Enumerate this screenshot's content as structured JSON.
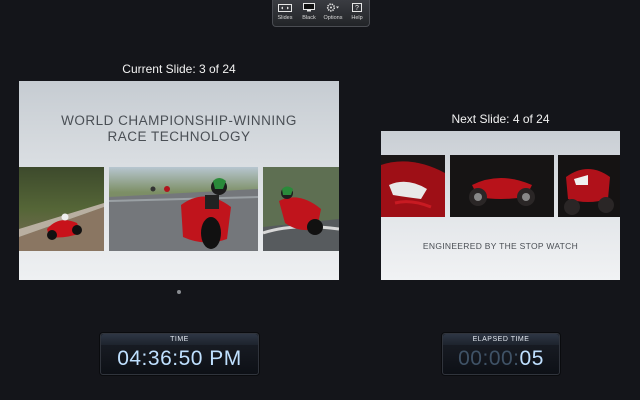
{
  "toolbar": {
    "items": [
      {
        "label": "Slides",
        "icon": "slides-icon"
      },
      {
        "label": "Black",
        "icon": "display-icon"
      },
      {
        "label": "Options",
        "icon": "gear-icon"
      },
      {
        "label": "Help",
        "icon": "help-icon"
      }
    ]
  },
  "current_slide": {
    "title": "Current Slide: 3 of 24",
    "heading_line1": "WORLD CHAMPIONSHIP-WINNING",
    "heading_line2": "RACE TECHNOLOGY"
  },
  "next_slide": {
    "title": "Next Slide: 4 of 24",
    "caption": "ENGINEERED BY THE STOP WATCH"
  },
  "clock": {
    "label": "TIME",
    "value": "04:36:50 PM"
  },
  "elapsed": {
    "label": "ELAPSED TIME",
    "value_dim": "00:00:",
    "value_bright": "05"
  },
  "colors": {
    "background": "#14151a",
    "timer_text": "#bfe0ff"
  }
}
